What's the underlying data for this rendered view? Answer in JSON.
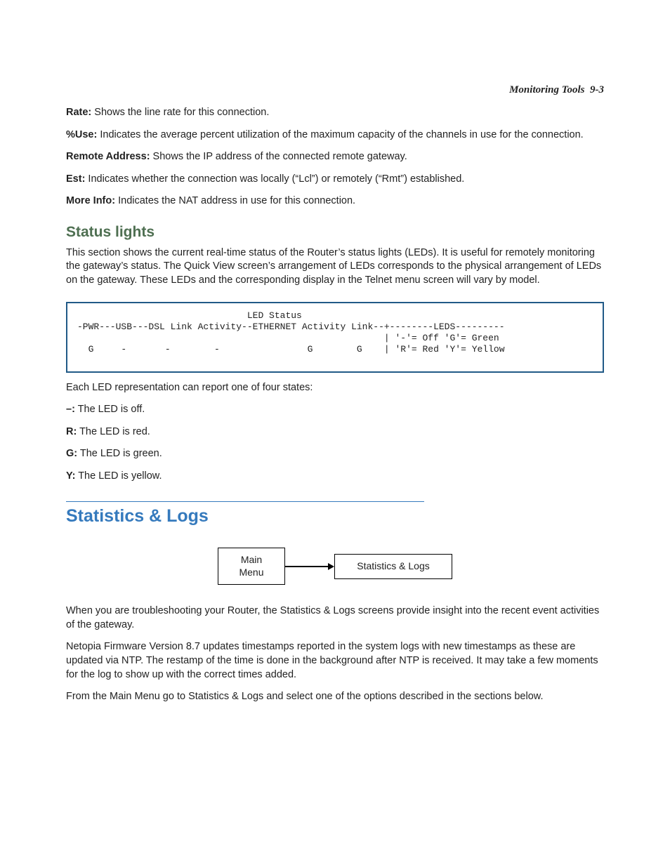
{
  "header": {
    "title": "Monitoring Tools",
    "page": "9-3"
  },
  "defs": {
    "rate": {
      "label": "Rate:",
      "text": " Shows the line rate for this connection."
    },
    "use": {
      "label": "%Use:",
      "text": " Indicates the average percent utilization of the maximum capacity of the channels in use for the connection."
    },
    "remaddr": {
      "label": "Remote Address:",
      "text": " Shows the IP address of the connected remote gateway."
    },
    "est": {
      "label": "Est:",
      "text": " Indicates whether the connection was locally (“Lcl”) or remotely (“Rmt”) established."
    },
    "moreinfo": {
      "label": "More Info:",
      "text": " Indicates the NAT address in use for this connection."
    }
  },
  "status_lights": {
    "heading": "Status lights",
    "para": "This section shows the current real-time status of the Router’s status lights (LEDs). It is useful for remotely monitoring the gateway’s status. The Quick View screen’s arrangement of LEDs corresponds to the physical arrangement of LEDs on the gateway. These LEDs and the corresponding display in the Telnet menu screen will vary by model.",
    "ledbox": "                               LED Status\n-PWR---USB---DSL Link Activity--ETHERNET Activity Link--+--------LEDS---------\n                                                        | '-'= Off 'G'= Green\n  G     -       -        -                G        G    | 'R'= Red 'Y'= Yellow",
    "intro": "Each LED representation can report one of four states:",
    "states": {
      "dash": {
        "label": "–:",
        "text": " The LED is off."
      },
      "r": {
        "label": "R:",
        "text": " The LED is red."
      },
      "g": {
        "label": "G:",
        "text": " The LED is green."
      },
      "y": {
        "label": "Y:",
        "text": " The LED is yellow."
      }
    }
  },
  "stats_logs": {
    "heading": "Statistics & Logs",
    "nav": {
      "from1": "Main",
      "from2": "Menu",
      "to": "Statistics & Logs"
    },
    "para1": "When you are troubleshooting your Router, the Statistics & Logs screens provide insight into the recent event activities of the gateway.",
    "para2": "Netopia Firmware Version 8.7 updates timestamps reported in the system logs with new timestamps as these are updated via NTP. The restamp of the time is done in the background after NTP is received. It may take a few moments for the log to show up with the correct times added.",
    "para3": "From the Main Menu go to Statistics & Logs and select one of the options described in the sections below."
  }
}
